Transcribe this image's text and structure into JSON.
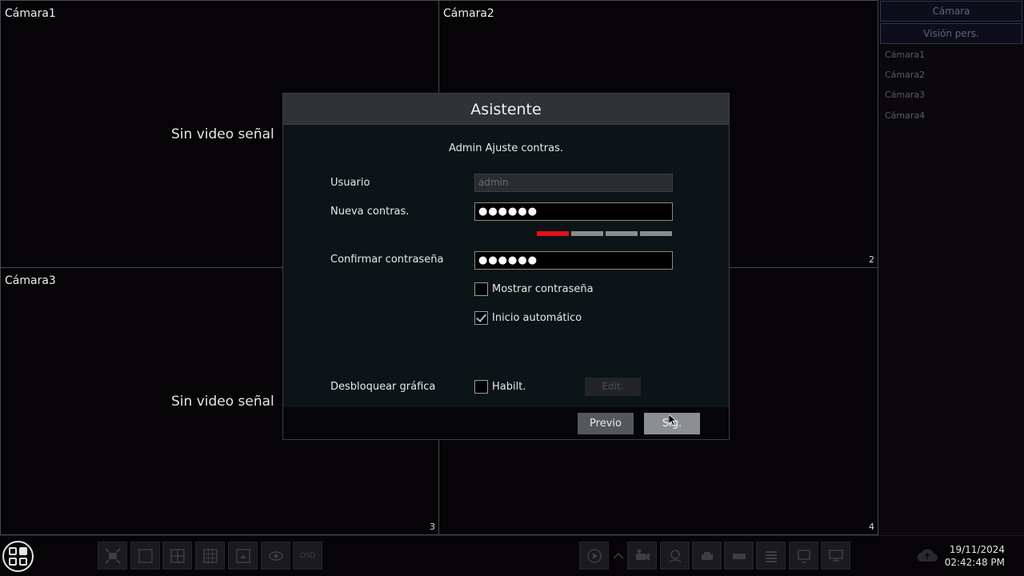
{
  "cameras": [
    {
      "title": "Cámara1",
      "status": "Sin video señal",
      "number": ""
    },
    {
      "title": "Cámara2",
      "status": "",
      "number": "2"
    },
    {
      "title": "Cámara3",
      "status": "Sin video señal",
      "number": "3"
    },
    {
      "title": "",
      "status": "",
      "number": "4"
    }
  ],
  "right_panel": {
    "tabs": [
      "Cámara",
      "Visión pers."
    ],
    "items": [
      "Cámara1",
      "Cámara2",
      "Cámara3",
      "Cámara4"
    ]
  },
  "dialog": {
    "title": "Asistente",
    "subtitle": "Admin Ajuste contras.",
    "user_label": "Usuario",
    "user_value": "admin",
    "new_password_label": "Nueva contras.",
    "new_password_value": "●●●●●●",
    "password_strength": 0.25,
    "confirm_label": "Confirmar contraseña",
    "confirm_value": "●●●●●●",
    "show_password_label": "Mostrar contraseña",
    "show_password_checked": false,
    "auto_start_label": "Inicio automático",
    "auto_start_checked": true,
    "unlock_pattern_label": "Desbloquear gráfica",
    "enable_label": "Habilt.",
    "enable_checked": false,
    "edit_label": "Edit.",
    "prev_label": "Previo",
    "next_label": "Sig."
  },
  "toolbar": {
    "osd_label": "OSD",
    "icons": [
      "fullscreen-icon",
      "single-view-icon",
      "quad-view-icon",
      "nine-view-icon",
      "sequence-icon",
      "visibility-icon",
      "osd-icon",
      "playback-icon",
      "chevron-up-icon",
      "record-camera-icon",
      "face-icon",
      "vehicle-icon",
      "device-icon",
      "storage-icon",
      "monitor-icon",
      "display-icon"
    ]
  },
  "status": {
    "date": "19/11/2024",
    "time": "02:42:48 PM"
  },
  "colors": {
    "strength_weak": "#e0121a",
    "strength_empty": "#8c8c8c",
    "dialog_header": "#2f3336",
    "accent_check": "#9cc4e8"
  }
}
